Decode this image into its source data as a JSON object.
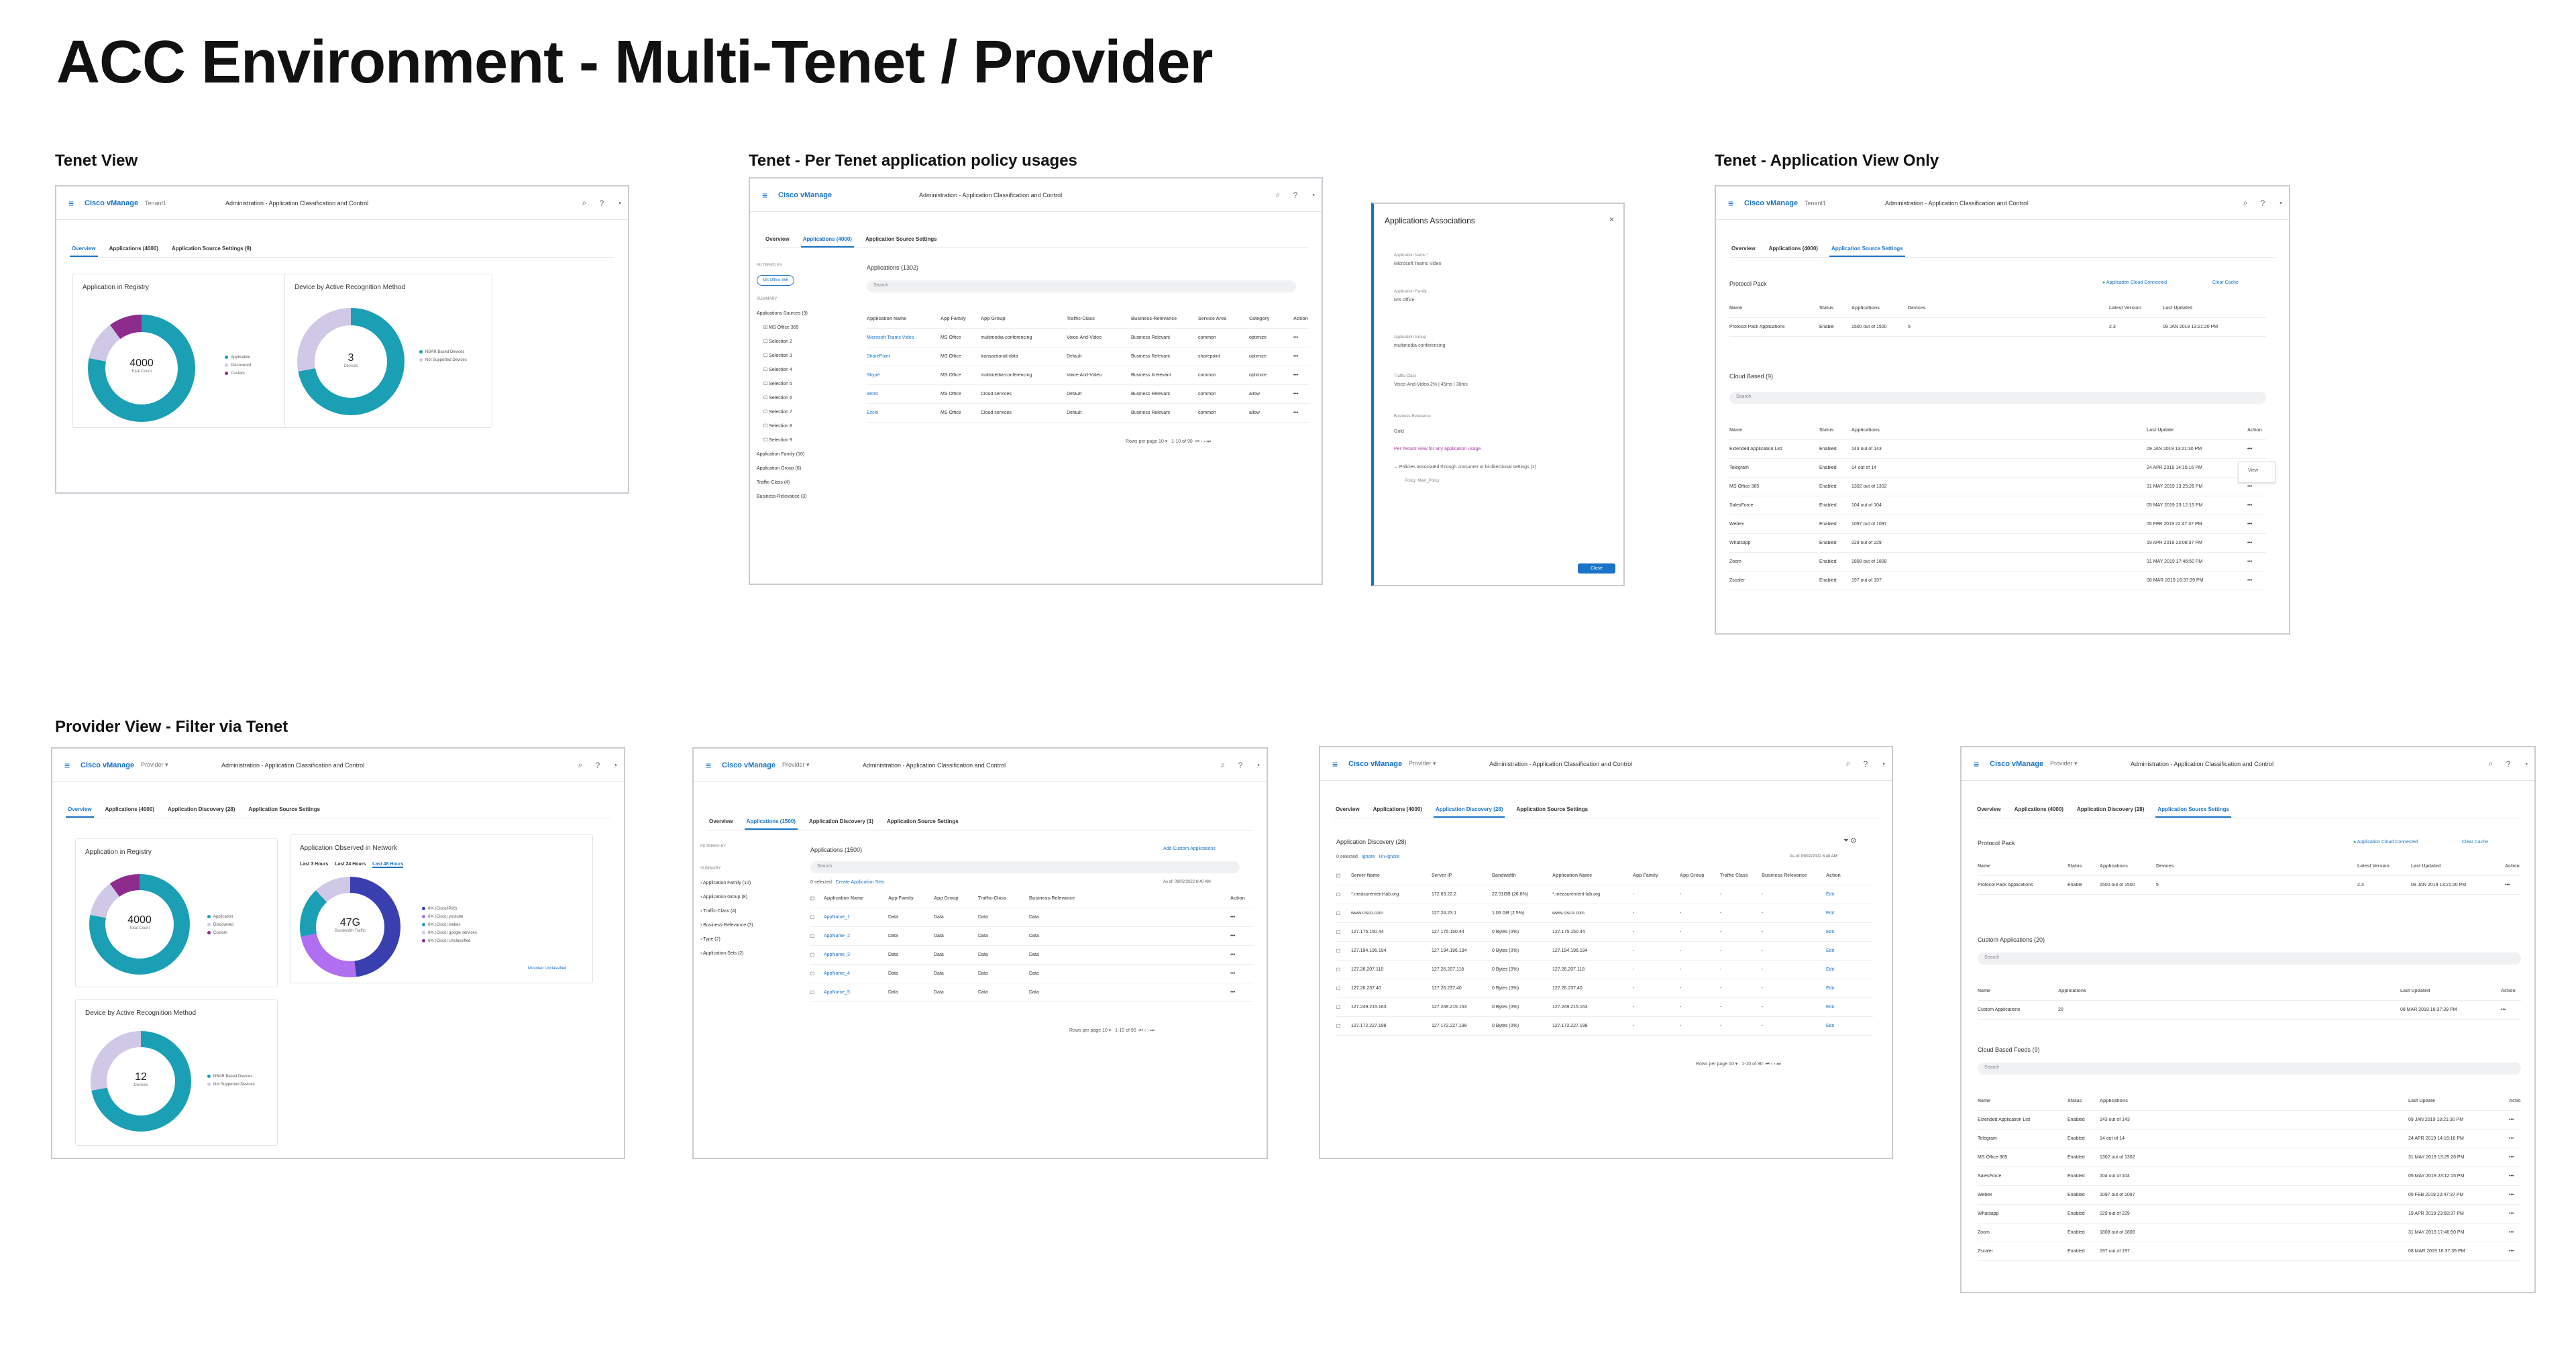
{
  "title": "ACC Environment - Multi-Tenet / Provider",
  "sections": {
    "tenet_view": "Tenet View",
    "per_tenet": "Tenet - Per Tenet application policy usages",
    "app_view_only": "Tenet - Application View Only",
    "provider": "Provider View - Filter via Tenet"
  },
  "header": {
    "brand": "Cisco vManage",
    "tenant": "Tenant1",
    "provider": "Provider",
    "page": "Administration - Application Classification and Control",
    "search_icon": "search-icon",
    "help_icon": "help-icon",
    "bell_icon": "bell-icon"
  },
  "tabs": {
    "overview": "Overview",
    "apps": "Applications (4000)",
    "apps1500": "Applications (1500)",
    "settings": "Application Source Settings",
    "settings2": "Application Source Settings (9)",
    "discovery28": "Application Discovery (28)",
    "discovery1": "Application Discovery (1)"
  },
  "registry": {
    "title": "Application in Registry",
    "value": "4000",
    "sub": "Total Count",
    "legend": [
      "Application",
      "Discovered",
      "Custom"
    ]
  },
  "device": {
    "title": "Device by Active Recognition Method",
    "value": "3",
    "value2": "12",
    "sub": "Devices",
    "legend": [
      "NBAR Based Devices",
      "Not Supported Devices"
    ]
  },
  "observed": {
    "title": "Application Observed in Network",
    "ranges": [
      "Last 3 Hours",
      "Last 24 Hours",
      "Last 48 Hours"
    ],
    "value": "47G",
    "sub": "Bandwidth Traffic",
    "legend": [
      "6% (Cisco/IPv6)",
      "6% (Cisco) youtube",
      "6% (Cisco) webex",
      "6% (Cisco) google services",
      "6% (Cisco) Unclassified"
    ],
    "link": "Mounted Unclassified"
  },
  "filter": {
    "filtered_by": "FILTERED BY",
    "chip": "MS Office 365",
    "summary": "SUMMARY",
    "groups": [
      "Applications Sources (9)",
      "Application Family (10)",
      "Application Group (8)",
      "Traffic-Class (4)",
      "Business-Relevance (3)"
    ],
    "items": [
      "MS Office 365",
      "Selection 2",
      "Selection 3",
      "Selection 4",
      "Selection 5",
      "Selection 6",
      "Selection 7",
      "Selection 8",
      "Selection 9"
    ]
  },
  "apps_table": {
    "title": "Applications (1302)",
    "search": "Search",
    "cols": [
      "Application Name",
      "App Family",
      "App Group",
      "Traffic-Class",
      "Business-Relevance",
      "Service Area",
      "Category",
      "Action"
    ],
    "rows": [
      [
        "Microsoft Teams Video",
        "MS Office",
        "multimedia-conferencing",
        "Voice-And-Video",
        "Business Relevant",
        "common",
        "optimize",
        "•••"
      ],
      [
        "SharePoint",
        "MS Office",
        "transactional-data",
        "Default",
        "Business Relevant",
        "sharepoint",
        "optimize",
        "•••"
      ],
      [
        "Skype",
        "MS Office",
        "multimedia-conferencing",
        "Voice-And-Video",
        "Business Irrelevant",
        "common",
        "optimize",
        "•••"
      ],
      [
        "Word",
        "MS Office",
        "Cloud services",
        "Default",
        "Business Relevant",
        "common",
        "allow",
        "•••"
      ],
      [
        "Excel",
        "MS Office",
        "Cloud services",
        "Default",
        "Business Relevant",
        "common",
        "allow",
        "•••"
      ]
    ],
    "pager": "Rows per page",
    "pagesize": "10",
    "range": "1-10 of 90"
  },
  "assoc": {
    "title": "Applications Associations",
    "fields": [
      [
        "Application Name *",
        "Microsoft Teams Video"
      ],
      [
        "Application Family",
        "MS Office"
      ],
      [
        "Application Group",
        "multimedia-conferencing"
      ],
      [
        "Traffic-Class",
        "Voice-And-Video 2% | 45ms | 30ms"
      ],
      [
        "Business-Relevance",
        "Gold"
      ]
    ],
    "tenant_link": "Per Tenant view for any application usage",
    "policies": "Policies associated through consumer or bi-directional settings (1)",
    "policy": "Policy: Main_Policy",
    "close": "Close"
  },
  "protocol": {
    "title": "Protocol Pack",
    "connected": "Application Cloud Connected",
    "clear": "Clear Cache",
    "cols": [
      "Name",
      "Status",
      "Applications",
      "Devices",
      "Latest Version",
      "Last Updated"
    ],
    "row": [
      "Protocol Pack Applications",
      "Enable",
      "1500 out of 1500",
      "5",
      "2.3",
      "09 JAN 2019 13:21:20 PM"
    ]
  },
  "cloud": {
    "title": "Cloud Based (9)",
    "title2": "Cloud Based Feeds (9)",
    "search": "Search",
    "cols": [
      "Name",
      "Status",
      "Applications",
      "Last Update",
      "Action"
    ],
    "rows": [
      [
        "Extended Application List",
        "Enabled",
        "143 out of 143",
        "09 JAN 2019 13:21:30 PM"
      ],
      [
        "Telegram",
        "Enabled",
        "14 out of 14",
        "24 APR 2019 14:16:16 PM"
      ],
      [
        "MS Office 365",
        "Enabled",
        "1302 out of 1302",
        "31 MAY 2019 13:25:26 PM"
      ],
      [
        "SalesForce",
        "Enabled",
        "104 out of 104",
        "05 MAY 2019 23:12:15 PM"
      ],
      [
        "Webex",
        "Enabled",
        "1097 out of 1097",
        "05 FEB 2019 22:47:37 PM"
      ],
      [
        "Whatsapp",
        "Enabled",
        "229 out of 229",
        "19 APR 2019 23:08:37 PM"
      ],
      [
        "Zoom",
        "Enabled",
        "1808 out of 1808",
        "31 MAY 2019 17:46:50 PM"
      ],
      [
        "Zscaler",
        "Enabled",
        "197 out of 197",
        "08 MAR 2019 16:37:39 PM"
      ]
    ],
    "view": "View"
  },
  "custom": {
    "add": "Add Custom Applications",
    "title": "Applications (1500)",
    "selected": "0 selected",
    "create": "Create Application Sets",
    "asof": "As of: 09/02/2022 8:40 AM",
    "cols": [
      "Application Name",
      "App Family",
      "App Group",
      "Traffic-Class",
      "Business-Relevance",
      "Action"
    ],
    "rows": [
      "AppName_1",
      "AppName_2",
      "AppName_3",
      "AppName_4",
      "AppName_5"
    ],
    "data": "Data",
    "groups": [
      "Application Family (10)",
      "Application Group (8)",
      "Traffic-Class (4)",
      "Business-Relevance (3)",
      "Type (2)",
      "Application Sets (2)"
    ]
  },
  "discovery": {
    "title": "Application Discovery (28)",
    "selected": "0 selected",
    "ignore": "Ignore",
    "unignore": "Un-ignore",
    "cols": [
      "Server Name",
      "Server IP",
      "Bandwidth",
      "Application Name",
      "App Family",
      "App Group",
      "Traffic Class",
      "Business Relevance",
      "Action"
    ],
    "rows": [
      [
        "*.measurement-lab.org",
        "172.63.22.2",
        "22.01GB (26.6%)",
        "*.measurement-lab.org"
      ],
      [
        "www.cisco.com",
        "127.24.23.1",
        "1.06 GB (2.5%)",
        "www.cisco.com"
      ],
      [
        "127.175.150.44",
        "127.175.150.44",
        "0 Bytes (0%)",
        "127.175.150.44"
      ],
      [
        "127.194.196.194",
        "127.194.196.194",
        "0 Bytes (0%)",
        "127.194.196.194"
      ],
      [
        "127.26.207.118",
        "127.26.207.118",
        "0 Bytes (0%)",
        "127.26.207.118"
      ],
      [
        "127.26.237.40",
        "127.26.237.40",
        "0 Bytes (0%)",
        "127.26.237.40"
      ],
      [
        "127.249.215.163",
        "127.249.215.163",
        "0 Bytes (0%)",
        "127.249.215.163"
      ],
      [
        "127.172.227.198",
        "127.172.227.198",
        "0 Bytes (0%)",
        "127.172.227.198"
      ]
    ],
    "edit": "Edit",
    "dash": "-"
  },
  "customapps": {
    "title": "Custom Applications (20)",
    "cols": [
      "Name",
      "Applications",
      "Last Updated",
      "Action"
    ],
    "row": [
      "Custom Applications",
      "20",
      "08 MAR 2019 16:37:39 PM"
    ]
  }
}
